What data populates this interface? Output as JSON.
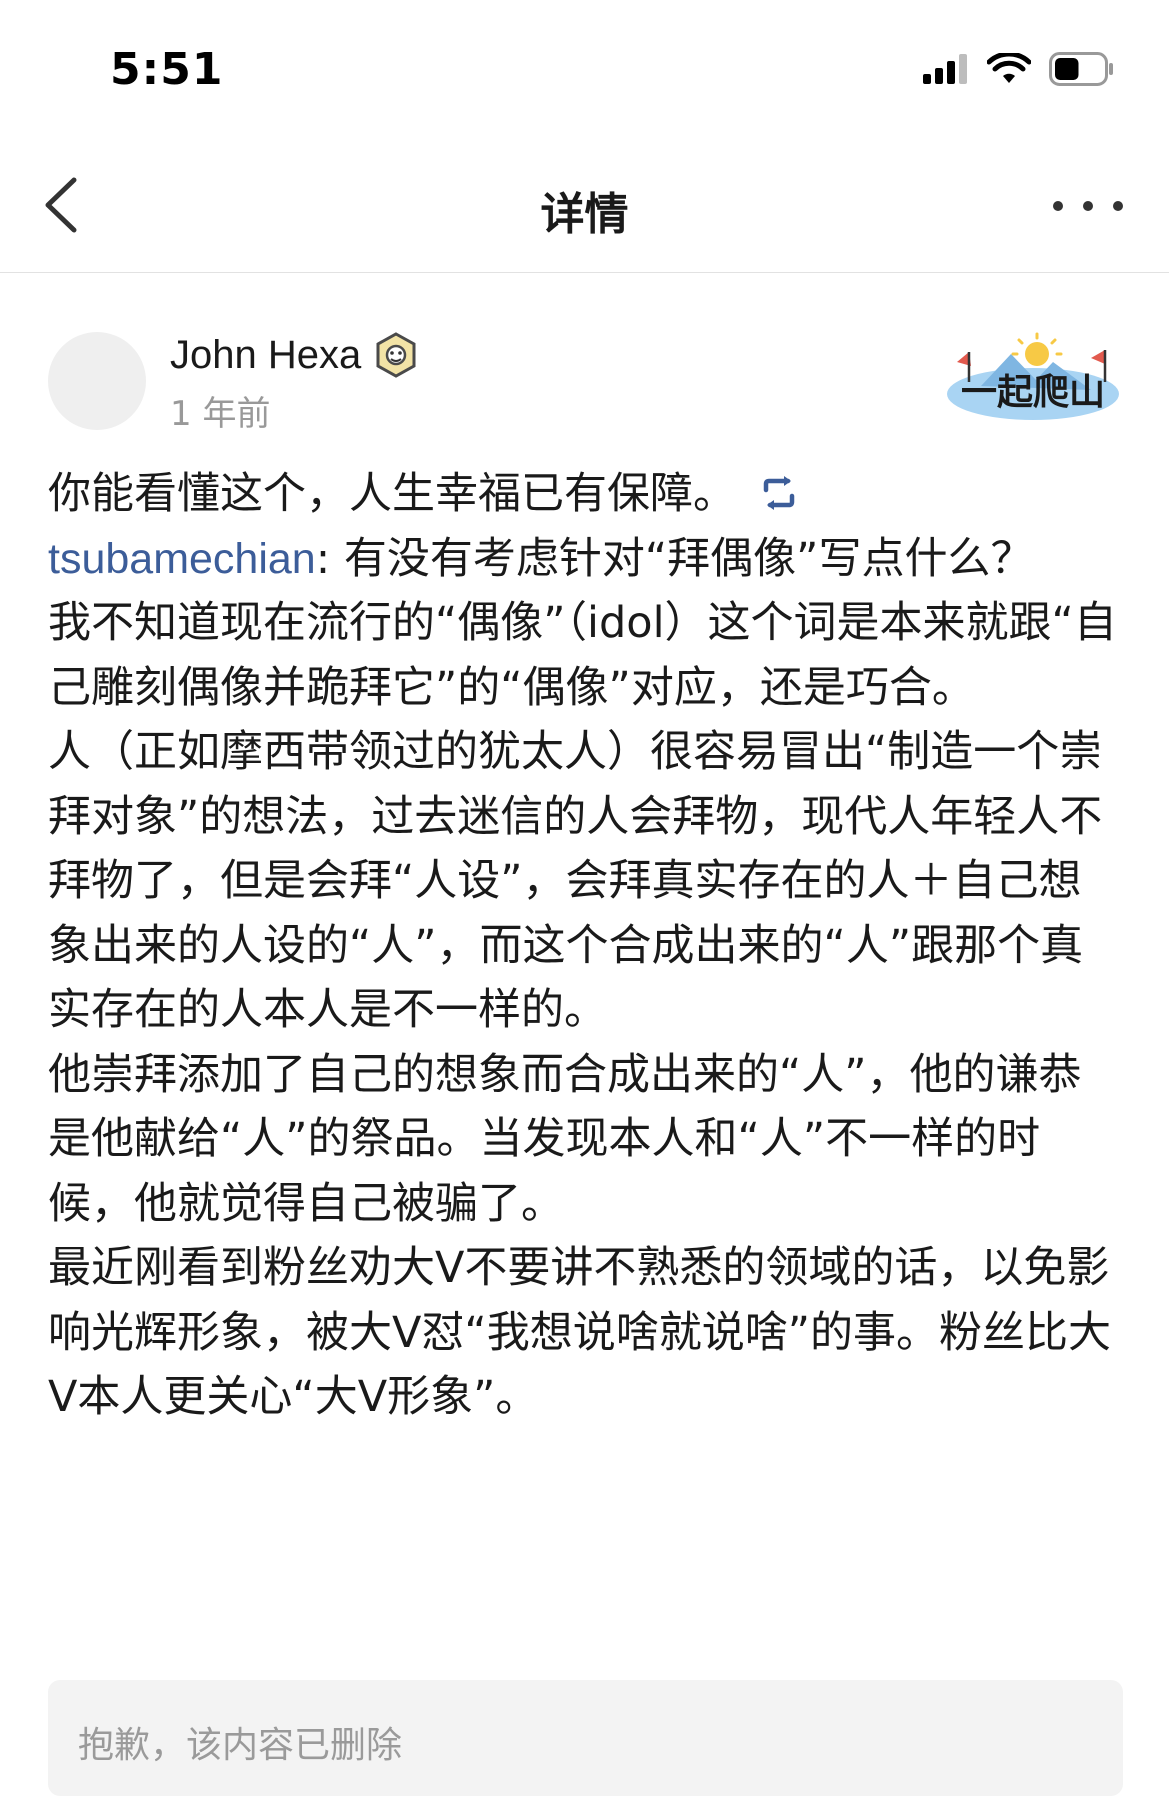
{
  "status_bar": {
    "time": "5:51",
    "battery_level": 0.5
  },
  "nav": {
    "title": "详情"
  },
  "post": {
    "author": "John Hexa",
    "time": "1 年前",
    "group_logo_text": "一起爬山",
    "paragraphs": {
      "p0": "你能看懂这个，人生幸福已有保障。",
      "p1_mention": "tsubamechian",
      "p1_text": ": 有没有考虑针对“拜偶像”写点什么？",
      "p2": "我不知道现在流行的“偶像”（idol）这个词是本来就跟“自己雕刻偶像并跪拜它”的“偶像”对应，还是巧合。",
      "p3": "人（正如摩西带领过的犹太人）很容易冒出“制造一个崇拜对象”的想法，过去迷信的人会拜物，现代人年轻人不拜物了，但是会拜“人设”，会拜真实存在的人＋自己想象出来的人设的“人”，而这个合成出来的“人”跟那个真实存在的人本人是不一样的。",
      "p4": "他崇拜添加了自己的想象而合成出来的“人”，他的谦恭是他献给“人”的祭品。当发现本人和“人”不一样的时候，他就觉得自己被骗了。",
      "p5": "最近刚看到粉丝劝大Ⅴ不要讲不熟悉的领域的话，以免影响光辉形象，被大Ⅴ怼“我想说啥就说啥”的事。粉丝比大Ⅴ本人更关心“大Ⅴ形象”。"
    },
    "deleted_notice": "抱歉，该内容已删除"
  },
  "icons": {
    "back": "chevron-left-icon",
    "more": "more-dots-icon",
    "repost": "repost-icon",
    "badge": "badge-icon",
    "signal": "signal-icon",
    "wifi": "wifi-icon",
    "battery": "battery-icon"
  },
  "colors": {
    "mention": "#3c5d99",
    "muted": "#999999",
    "repost": "#3c5d99"
  }
}
